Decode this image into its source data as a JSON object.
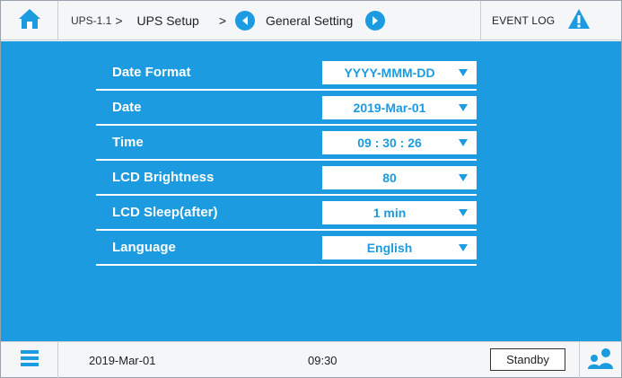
{
  "header": {
    "home_icon": "home-icon",
    "crumb_id": "UPS-1.1",
    "crumb_sep": ">",
    "crumb_setup": "UPS Setup",
    "crumb_sep2": ">",
    "current_page": "General Setting",
    "event_log": "EVENT LOG",
    "warning_icon": "warning-icon"
  },
  "settings": [
    {
      "label": "Date Format",
      "value": "YYYY-MMM-DD"
    },
    {
      "label": "Date",
      "value": "2019-Mar-01"
    },
    {
      "label": "Time",
      "value": "09 : 30 : 26"
    },
    {
      "label": "LCD Brightness",
      "value": "80"
    },
    {
      "label": "LCD Sleep(after)",
      "value": "1 min"
    },
    {
      "label": "Language",
      "value": "English"
    }
  ],
  "footer": {
    "menu_icon": "menu-icon",
    "date": "2019-Mar-01",
    "time": "09:30",
    "status": "Standby",
    "user_icon": "users-icon"
  },
  "colors": {
    "accent": "#1c9be0",
    "header_bg": "#f4f6f8",
    "text": "#222222"
  }
}
